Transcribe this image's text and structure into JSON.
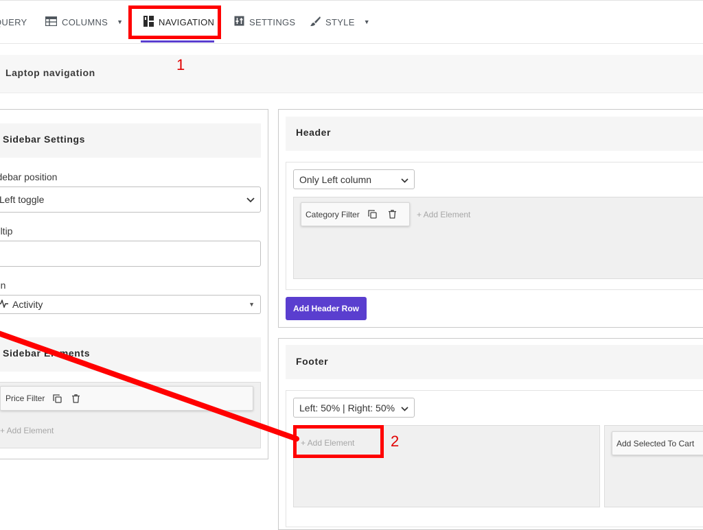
{
  "tabs": [
    {
      "label": "QUERY",
      "icon": "funnel-icon"
    },
    {
      "label": "COLUMNS",
      "icon": "table-icon"
    },
    {
      "label": "NAVIGATION",
      "icon": "layout-icon"
    },
    {
      "label": "SETTINGS",
      "icon": "sliders-icon"
    },
    {
      "label": "STYLE",
      "icon": "brush-icon"
    }
  ],
  "section_title": "Laptop navigation",
  "sidebar": {
    "settings_title": "Sidebar Settings",
    "position_label": "Sidebar position",
    "position_value": "Left toggle",
    "tooltip_label": "Tooltip",
    "tooltip_value": "",
    "icon_label": "Icon",
    "icon_value": "Activity",
    "elements_title": "Sidebar Elements",
    "element_chip": "Price Filter",
    "add_element": "+ Add Element"
  },
  "header": {
    "title": "Header",
    "layout_value": "Only Left column",
    "chip": "Category Filter",
    "add_element": "+ Add Element",
    "add_row_button": "Add Header Row"
  },
  "footer": {
    "title": "Footer",
    "layout_value": "Left: 50% | Right: 50%",
    "add_element": "+ Add Element",
    "right_chip": "Add Selected To Cart"
  },
  "annotations": {
    "one": "1",
    "two": "2"
  },
  "colors": {
    "accent": "#5a3ecf",
    "annotation": "#ff0000"
  }
}
